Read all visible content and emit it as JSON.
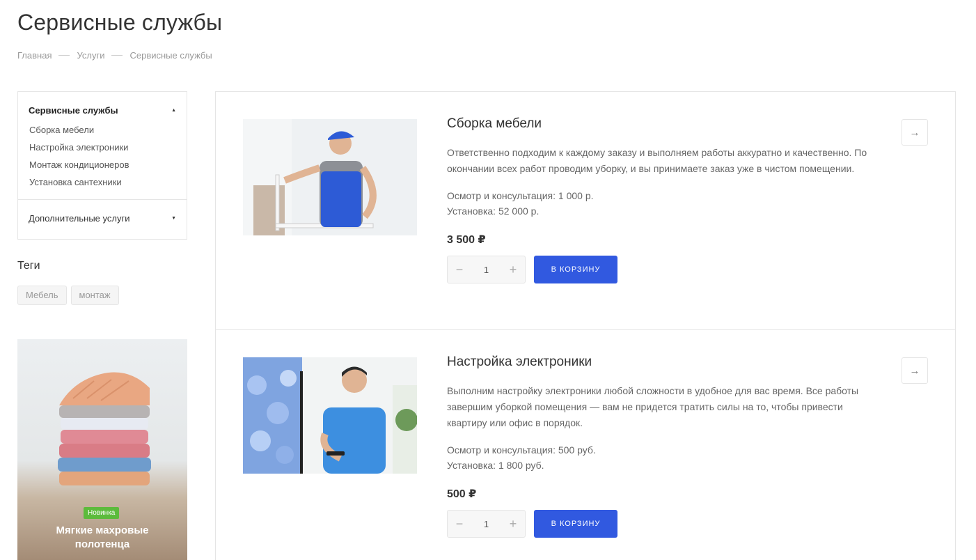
{
  "page": {
    "title": "Сервисные службы"
  },
  "breadcrumb": [
    "Главная",
    "Услуги",
    "Сервисные службы"
  ],
  "sidebar": {
    "active_group": "Сервисные службы",
    "items": [
      "Сборка мебели",
      "Настройка электроники",
      "Монтаж кондиционеров",
      "Установка сантехники"
    ],
    "second_group": "Дополнительные услуги"
  },
  "tags": {
    "title": "Теги",
    "items": [
      "Мебель",
      "монтаж"
    ]
  },
  "promo": {
    "badge": "Новинка",
    "title": "Мягкие махровые полотенца",
    "badge_color": "#5cbb3c"
  },
  "services": [
    {
      "title": "Сборка мебели",
      "description": "Ответственно подходим к каждому заказу и выполняем работы аккуратно и качественно. По окончании всех работ проводим уборку, и вы принимаете заказ уже в чистом помещении.",
      "prop1": "Осмотр и консультация:  1 000 р.",
      "prop2": "Установка:  52 000 р.",
      "price": "3 500 ₽",
      "quantity": "1",
      "cart_label": "В корзину"
    },
    {
      "title": "Настройка электроники",
      "description": "Выполним настройку электроники любой сложности в удобное для вас время. Все работы завершим уборкой помещения — вам не придется тратить силы на то, чтобы привести квартиру или офис в порядок.",
      "prop1": "Осмотр и консультация:  500 руб.",
      "prop2": "Установка:  1 800 руб.",
      "price": "500 ₽",
      "quantity": "1",
      "cart_label": "В корзину"
    }
  ],
  "colors": {
    "accent": "#3159e0",
    "uniform_blue": "#2d5bd6",
    "shirt_blue": "#3d8fe0"
  },
  "icons": {
    "minus": "−",
    "plus": "+",
    "arrow": "→"
  }
}
